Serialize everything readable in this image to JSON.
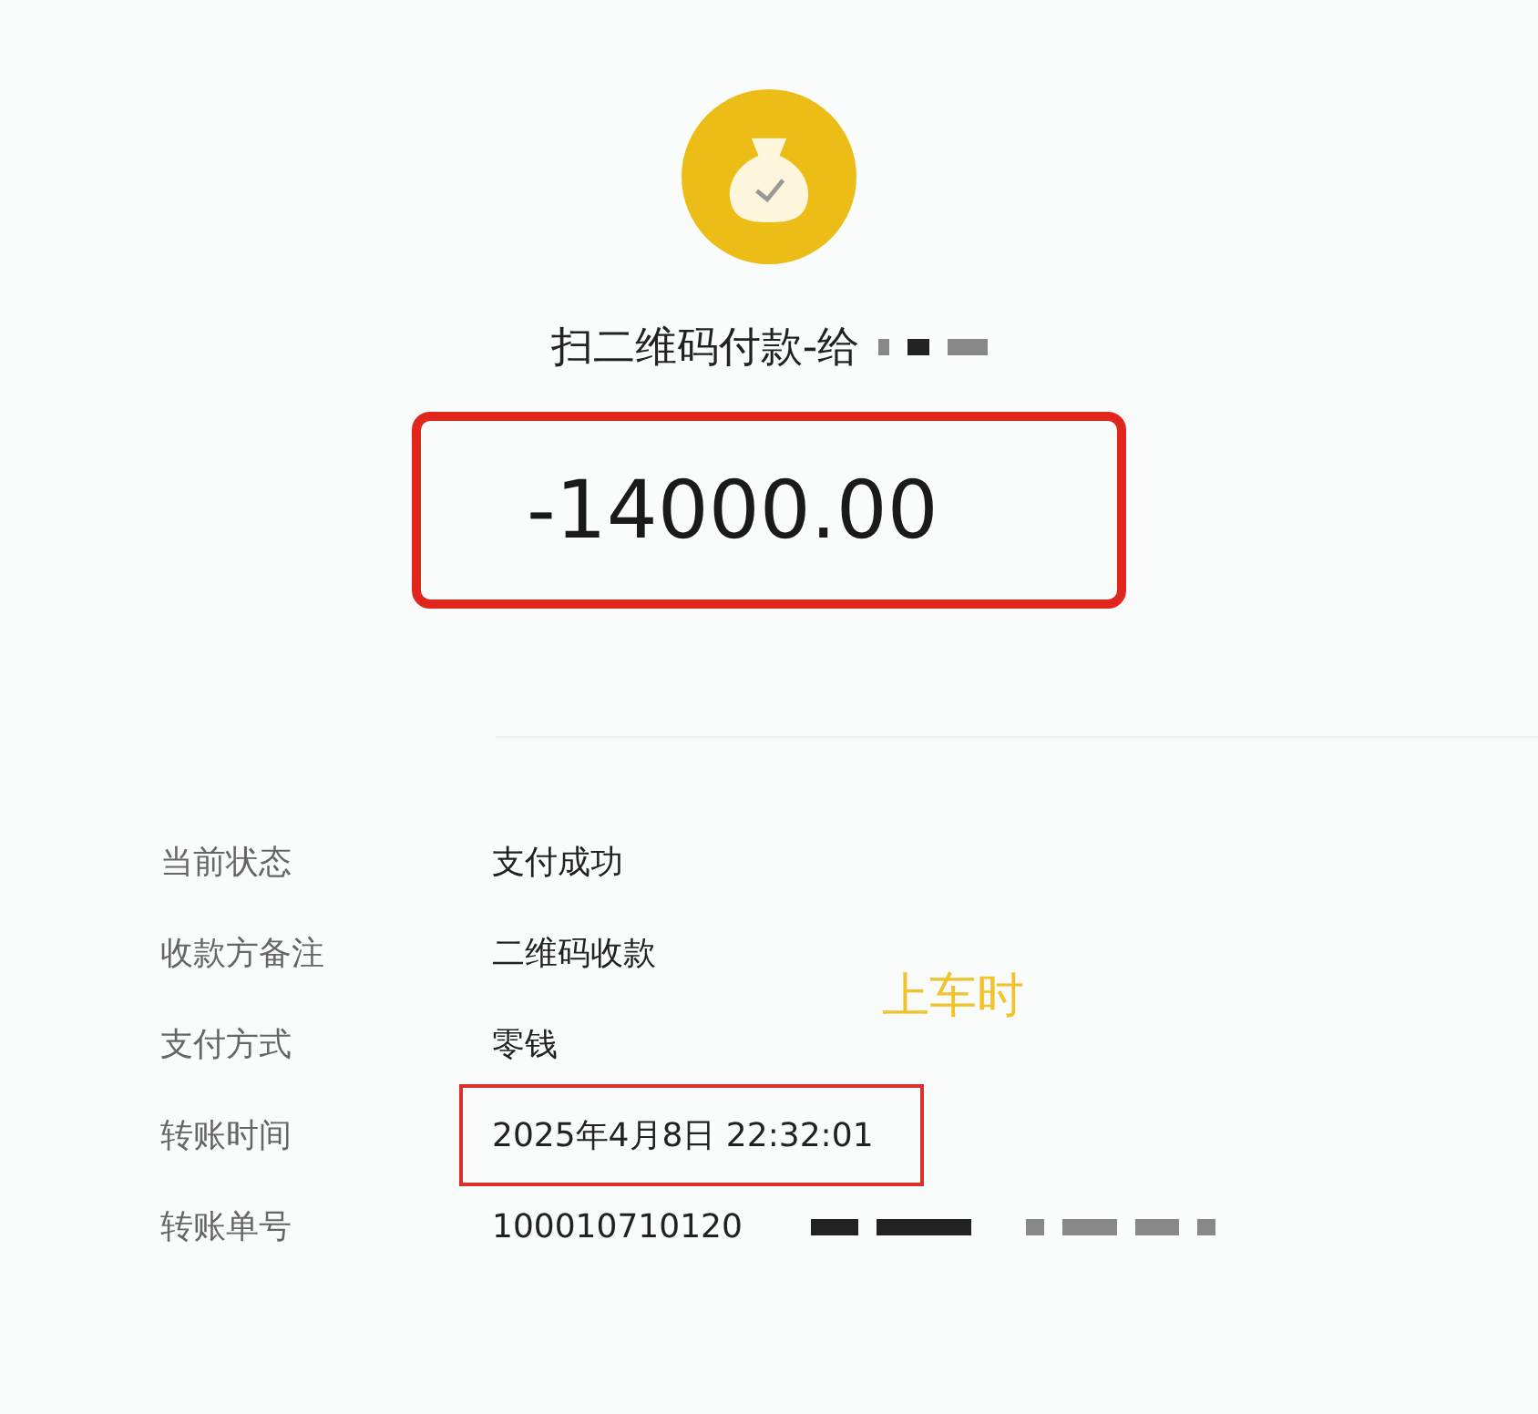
{
  "header": {
    "title": "扫二维码付款-给",
    "title_redacted": true,
    "amount": "-14000.00",
    "amount_highlighted": true
  },
  "details": [
    {
      "label": "当前状态",
      "value": "支付成功",
      "highlighted": false,
      "redacted": false
    },
    {
      "label": "收款方备注",
      "value": "二维码收款",
      "highlighted": false,
      "redacted": false
    },
    {
      "label": "支付方式",
      "value": "零钱",
      "highlighted": false,
      "redacted": false
    },
    {
      "label": "转账时间",
      "value": "2025年4月8日 22:32:01",
      "highlighted": true,
      "redacted": false
    },
    {
      "label": "转账单号",
      "value": "100010710120",
      "highlighted": false,
      "redacted": true
    }
  ],
  "annotation": {
    "text": "上车时"
  }
}
